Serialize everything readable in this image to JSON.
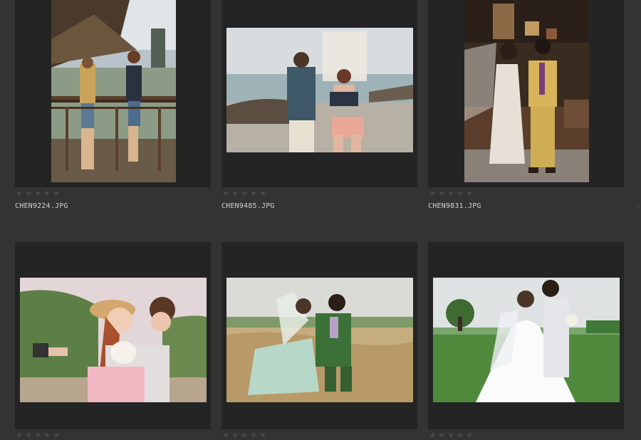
{
  "grid": {
    "items": [
      {
        "filename": "CHEN9224.JPG",
        "rating": 0,
        "max_rating": 5,
        "star_glyph": "★",
        "scene": "pavilion"
      },
      {
        "filename": "CHEN9485.JPG",
        "rating": 0,
        "max_rating": 5,
        "star_glyph": "★",
        "scene": "beach"
      },
      {
        "filename": "CHEN9831.JPG",
        "rating": 0,
        "max_rating": 5,
        "star_glyph": "★",
        "scene": "interior"
      },
      {
        "filename": "",
        "rating": 0,
        "max_rating": 5,
        "star_glyph": "★",
        "scene": "hillside"
      },
      {
        "filename": "",
        "rating": 0,
        "max_rating": 5,
        "star_glyph": "★",
        "scene": "haystack"
      },
      {
        "filename": "",
        "rating": 0,
        "max_rating": 5,
        "star_glyph": "★",
        "scene": "meadow"
      }
    ]
  },
  "colors": {
    "background": "#333333",
    "cell_frame": "#242424",
    "star_empty": "#4a4a4a",
    "filename_text": "#d0d0d0"
  }
}
